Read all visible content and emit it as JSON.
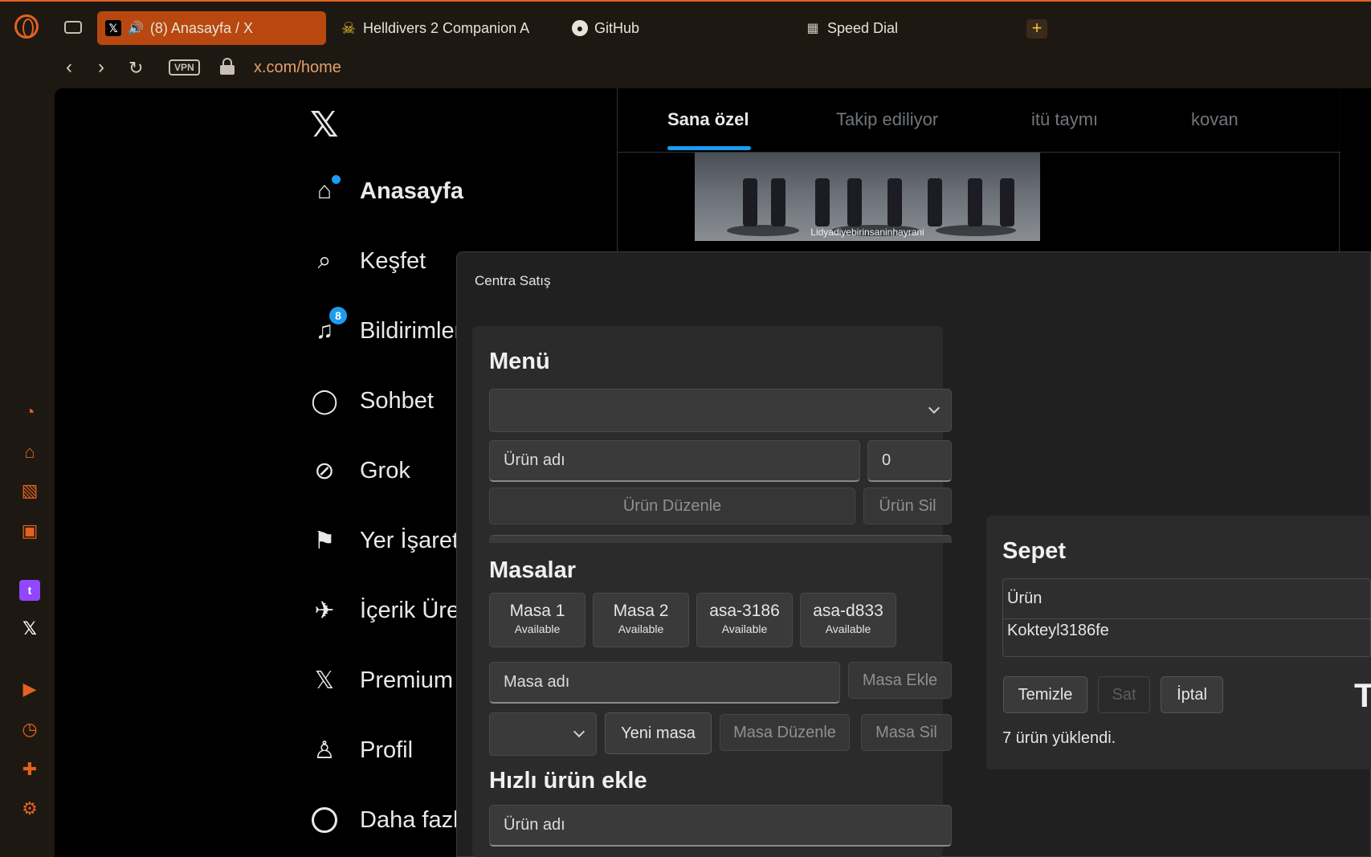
{
  "browser": {
    "tabs": [
      {
        "label": "(8) Anasayfa / X",
        "active": true
      },
      {
        "label": "Helldivers 2 Companion A",
        "active": false
      },
      {
        "label": "GitHub",
        "active": false
      },
      {
        "label": "Speed Dial",
        "active": false
      }
    ],
    "new_tab_label": "+",
    "vpn_label": "VPN",
    "url": "x.com/home"
  },
  "x": {
    "nav": [
      {
        "label": "Anasayfa",
        "icon": "home-icon"
      },
      {
        "label": "Keşfet",
        "icon": "search-icon"
      },
      {
        "label": "Bildirimler",
        "icon": "bell-icon",
        "badge": "8"
      },
      {
        "label": "Sohbet",
        "icon": "chat-icon"
      },
      {
        "label": "Grok",
        "icon": "grok-icon"
      },
      {
        "label": "Yer İşaretleri",
        "icon": "bookmark-icon"
      },
      {
        "label": "İçerik Üreticileri",
        "icon": "rocket-icon"
      },
      {
        "label": "Premium",
        "icon": "x-logo-icon"
      },
      {
        "label": "Profil",
        "icon": "person-icon"
      },
      {
        "label": "Daha fazla",
        "icon": "more-icon"
      }
    ],
    "timeline_tabs": [
      "Sana özel",
      "Takip ediliyor",
      "itü taymı",
      "kovan"
    ],
    "video_watermark": "Lidyadiyebirinsaninhayrani"
  },
  "app": {
    "title": "Centra Satış",
    "menu": {
      "heading": "Menü",
      "product_name_placeholder": "Ürün adı",
      "price_value": "0",
      "edit_button": "Ürün Düzenle",
      "delete_button": "Ürün Sil"
    },
    "tables": {
      "heading": "Masalar",
      "items": [
        {
          "name": "Masa 1",
          "status": "Available"
        },
        {
          "name": "Masa 2",
          "status": "Available"
        },
        {
          "name": "asa-3186",
          "status": "Available"
        },
        {
          "name": "asa-d833",
          "status": "Available"
        }
      ],
      "table_name_placeholder": "Masa adı",
      "add_button": "Masa Ekle",
      "new_button": "Yeni masa",
      "edit_button": "Masa Düzenle",
      "delete_button": "Masa Sil"
    },
    "quick_add": {
      "heading": "Hızlı ürün ekle",
      "product_name_placeholder": "Ürün adı"
    },
    "cart": {
      "heading": "Sepet",
      "column_header": "Ürün",
      "rows": [
        "Kokteyl3186fe"
      ],
      "clear_button": "Temizle",
      "sell_button": "Sat",
      "cancel_button": "İptal",
      "status_text": "7 ürün yüklendi.",
      "total_letter": "T"
    }
  },
  "colors": {
    "accent": "#e2621f",
    "x_blue": "#1d9bf0"
  }
}
